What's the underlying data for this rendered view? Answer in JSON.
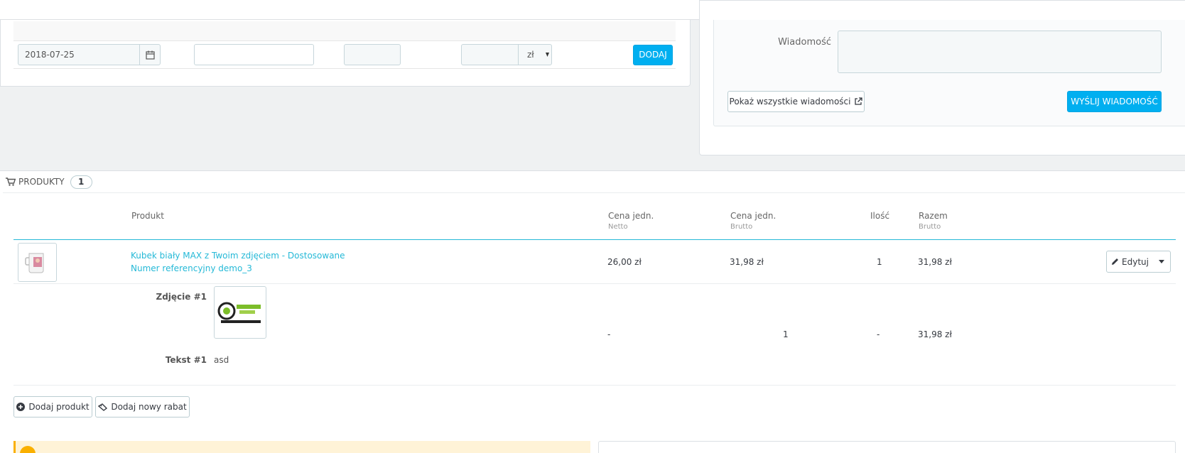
{
  "payments": {
    "date_value": "2018-07-25",
    "currency": "zł",
    "add_label": "DODAJ"
  },
  "messages": {
    "label": "Wiadomość",
    "show_all_label": "Pokaż wszystkie wiadomości",
    "send_label": "WYŚLIJ WIADOMOŚĆ"
  },
  "products": {
    "heading": "PRODUKTY",
    "count": "1",
    "columns": {
      "product": "Produkt",
      "unit_price_net": "Cena jedn.",
      "unit_price_net_sub": "Netto",
      "unit_price_gross": "Cena jedn.",
      "unit_price_gross_sub": "Brutto",
      "qty": "Ilość",
      "total": "Razem",
      "total_sub": "Brutto"
    },
    "row": {
      "name": "Kubek biały MAX z Twoim zdjęciem - Dostosowane",
      "reference": "Numer referencyjny demo_3",
      "unit_net": "26,00 zł",
      "unit_gross": "31,98 zł",
      "qty": "1",
      "total": "31,98 zł",
      "edit_label": "Edytuj"
    },
    "customization": {
      "image_label": "Zdjęcie #1",
      "text_label": "Tekst #1",
      "text_value": "asd",
      "unit_net": "-",
      "unit_gross": "1",
      "qty": "-",
      "total": "31,98 zł"
    },
    "add_product_label": "Dodaj produkt",
    "add_discount_label": "Dodaj nowy rabat"
  }
}
